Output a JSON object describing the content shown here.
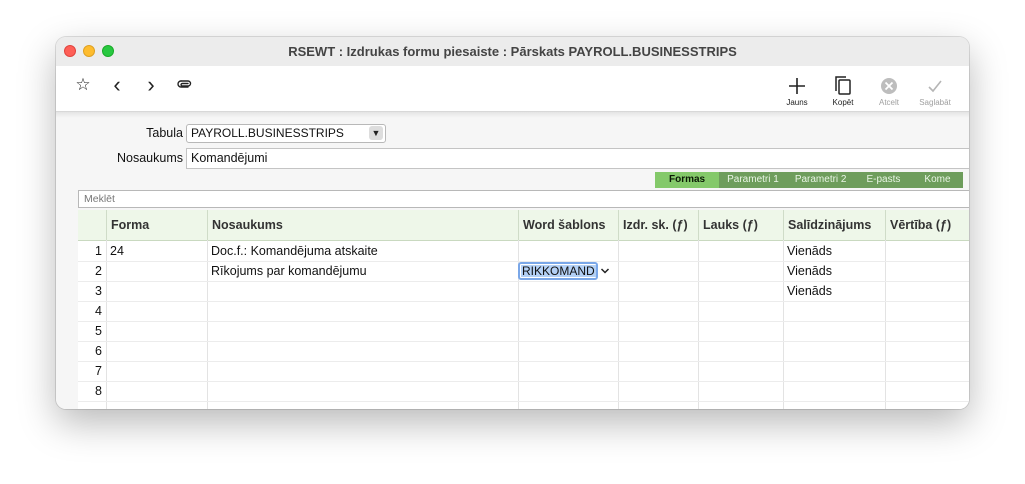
{
  "window": {
    "title": "RSEWT : Izdrukas formu piesaiste : Pārskats PAYROLL.BUSINESSTRIPS"
  },
  "toolbar": {
    "buttons": [
      {
        "label": "Jauns",
        "icon": "plus-icon"
      },
      {
        "label": "Kopēt",
        "icon": "copy-icon"
      },
      {
        "label": "Atcelt",
        "icon": "cancel-icon"
      },
      {
        "label": "Saglabāt",
        "icon": "checkmark-icon"
      }
    ],
    "nav_icons": [
      "star-icon",
      "back-icon",
      "forward-icon",
      "paperclip-icon"
    ],
    "glyphs": {
      "star": "☆",
      "back": "‹",
      "forward": "›"
    }
  },
  "form": {
    "tabula_label": "Tabula",
    "tabula_value": "PAYROLL.BUSINESSTRIPS",
    "nosaukums_label": "Nosaukums",
    "nosaukums_value": "Komandējumi"
  },
  "tabs": [
    "Formas",
    "Parametri 1",
    "Parametri 2",
    "E-pasts",
    "Kome"
  ],
  "active_tab": "Formas",
  "search": {
    "placeholder": "Meklēt"
  },
  "grid": {
    "columns": [
      "Forma",
      "Nosaukums",
      "Word šablons",
      "Izdr. sk. (ƒ)",
      "Lauks (ƒ)",
      "Salīdzinājums",
      "Vērtība (ƒ)"
    ],
    "rows": [
      {
        "n": "1",
        "forma": "24",
        "nosaukums": "Doc.f.: Komandējuma atskaite",
        "word": "",
        "izdr": "",
        "lauks": "",
        "salidz": "Vienāds",
        "vert": ""
      },
      {
        "n": "2",
        "forma": "",
        "nosaukums": "Rīkojums par komandējumu",
        "word": "RIKKOMAND",
        "izdr": "",
        "lauks": "",
        "salidz": "Vienāds",
        "vert": ""
      },
      {
        "n": "3",
        "forma": "",
        "nosaukums": "",
        "word": "",
        "izdr": "",
        "lauks": "",
        "salidz": "Vienāds",
        "vert": ""
      },
      {
        "n": "4",
        "forma": "",
        "nosaukums": "",
        "word": "",
        "izdr": "",
        "lauks": "",
        "salidz": "",
        "vert": ""
      },
      {
        "n": "5",
        "forma": "",
        "nosaukums": "",
        "word": "",
        "izdr": "",
        "lauks": "",
        "salidz": "",
        "vert": ""
      },
      {
        "n": "6",
        "forma": "",
        "nosaukums": "",
        "word": "",
        "izdr": "",
        "lauks": "",
        "salidz": "",
        "vert": ""
      },
      {
        "n": "7",
        "forma": "",
        "nosaukums": "",
        "word": "",
        "izdr": "",
        "lauks": "",
        "salidz": "",
        "vert": ""
      },
      {
        "n": "8",
        "forma": "",
        "nosaukums": "",
        "word": "",
        "izdr": "",
        "lauks": "",
        "salidz": "",
        "vert": ""
      }
    ]
  },
  "colors": {
    "tab_active": "#84c96a",
    "tab_inactive": "#6e9d5c",
    "header_bg": "#eef7e9",
    "selection": "#b3d0f5"
  }
}
